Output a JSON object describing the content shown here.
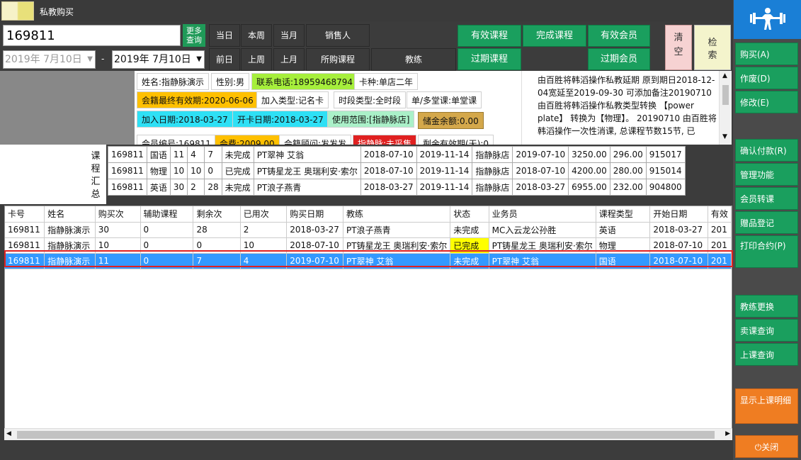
{
  "window": {
    "title": "私教购买"
  },
  "search": {
    "value": "169811",
    "more_label": "更多查询"
  },
  "dates": {
    "from": "2019年 7月10日",
    "to": "2019年 7月10日",
    "sep": "-"
  },
  "quick": {
    "today": "当日",
    "this_week": "本周",
    "this_month": "当月",
    "yesterday": "前日",
    "last_week": "上周",
    "last_month": "上月",
    "salesperson": "销售人",
    "course": "所购课程",
    "coach": "教练"
  },
  "filters": {
    "valid_course": "有效课程",
    "done_course": "完成课程",
    "valid_member": "有效会员",
    "expired_course": "过期课程",
    "expired_member": "过期会员",
    "clear": "清空",
    "search": "检索"
  },
  "member": {
    "name": "姓名:指静脉演示",
    "sex": "性别:男",
    "phone": "联系电话:18959468794",
    "card_type": "卡种:单店二年",
    "expire": "会籍最终有效期:2020-06-06",
    "join_type": "加入类型:记名卡",
    "time_type": "时段类型:全时段",
    "multi": "单/多堂课:单堂课",
    "join_date": "加入日期:2018-03-27",
    "open_date": "开卡日期:2018-03-27",
    "scope": "使用范围:[指静脉店]",
    "balance": "储金余额:0.00",
    "row4a": "会员编号:169811",
    "row4b": "会费:2009.00",
    "row4c": "会籍顾问:发发发",
    "row4d": "指静脉:未采集",
    "row4e": "剩余有效期(天):0"
  },
  "notes": "由百胜将韩滔操作私教延期 原到期日2018-12-04宽延至2019-09-30 可添加备注20190710由百胜将韩滔操作私教类型转换 【power plate】 转换为【物理】。 20190710 由百胜将韩滔操作一次性消课, 总课程节数15节, 已",
  "summary": {
    "label": "课程汇总",
    "rows": [
      [
        "169811",
        "国语",
        "11",
        "4",
        "7",
        "未完成",
        "PT翠神 艾翁",
        "2018-07-10",
        "2019-11-14",
        "指静脉店",
        "2019-07-10",
        "3250.00",
        "296.00",
        "915017"
      ],
      [
        "169811",
        "物理",
        "10",
        "10",
        "0",
        "已完成",
        "PT铸星龙王 奥瑞利安·索尔",
        "2018-07-10",
        "2019-11-14",
        "指静脉店",
        "2018-07-10",
        "4200.00",
        "280.00",
        "915014"
      ],
      [
        "169811",
        "英语",
        "30",
        "2",
        "28",
        "未完成",
        "PT浪子燕青",
        "2018-03-27",
        "2019-11-14",
        "指静脉店",
        "2018-03-27",
        "6955.00",
        "232.00",
        "904800"
      ]
    ]
  },
  "grid": {
    "headers": [
      "卡号",
      "姓名",
      "购买次",
      "辅助课程",
      "剩余次",
      "已用次",
      "购买日期",
      "教练",
      "状态",
      "业务员",
      "课程类型",
      "开始日期",
      "有效"
    ],
    "rows": [
      [
        "169811",
        "指静脉演示",
        "30",
        "0",
        "28",
        "2",
        "2018-03-27",
        "PT浪子燕青",
        "未完成",
        "MC入云龙公孙胜",
        "英语",
        "2018-03-27",
        "201"
      ],
      [
        "169811",
        "指静脉演示",
        "10",
        "0",
        "0",
        "10",
        "2018-07-10",
        "PT铸星龙王 奥瑞利安·索尔",
        "已完成",
        "PT铸星龙王 奥瑞利安·索尔",
        "物理",
        "2018-07-10",
        "201"
      ],
      [
        "169811",
        "指静脉演示",
        "11",
        "0",
        "7",
        "4",
        "2019-07-10",
        "PT翠神 艾翁",
        "未完成",
        "PT翠神 艾翁",
        "国语",
        "2018-07-10",
        "201"
      ]
    ]
  },
  "sidebar": {
    "buy": "购买(A)",
    "void": "作废(D)",
    "edit": "修改(E)",
    "confirm_pay": "确认付款(R)",
    "manage": "管理功能",
    "member_transfer": "会员转课",
    "gift": "赠品登记",
    "print": "打印合约(P)",
    "coach_change": "教练更换",
    "sold_query": "卖课查询",
    "class_query": "上课查询",
    "show_detail": "显示上课明细",
    "close": "关闭"
  },
  "colors": {
    "green": "#1a9f5e",
    "blue": "#1a7fd6",
    "orange": "#ef7d22",
    "selection": "#3399ff"
  }
}
